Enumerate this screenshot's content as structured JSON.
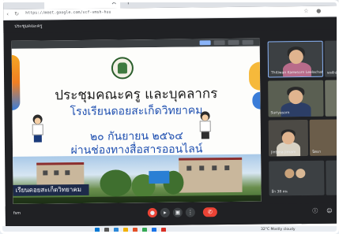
{
  "browser": {
    "url": "https://meet.google.com/xcf-vmsh-huu",
    "new_tab_symbol": "+",
    "close_symbol": "×"
  },
  "meet": {
    "header_title": "ประชุมคณะครู",
    "meeting_code": "fsm"
  },
  "slide": {
    "title": "ประชุมคณะครู และบุคลากร",
    "school": "โรงเรียนดอยสะเก็ดวิทยาคม",
    "date": "๒๐ กันยายน ๒๕๖๔",
    "online": "ผ่านช่องทางสื่อสารออนไลน์",
    "sign_text": "เรียนดอยสะเก็ดวิทยาคม"
  },
  "participants": [
    {
      "name": "Thitiwan Kaewsorn Leelachat"
    },
    {
      "name": "Suriyasorn"
    },
    {
      "name": "Jintana jirnam"
    },
    {
      "name": "อีก 38 คน"
    }
  ],
  "right_edge_labels": [
    "พรศักดิ์",
    "นิตยา"
  ],
  "controls": {
    "mic_icon": "mic-off-icon",
    "cam_icon": "camera-icon",
    "present_icon": "present-icon",
    "more_icon": "more-icon",
    "end_icon": "end-call-icon"
  },
  "taskbar": {
    "weather": "32°C  Mostly cloudy"
  },
  "colors": {
    "meet_bg": "#202124",
    "tile_bg": "#3c4043",
    "end_call": "#ea4335",
    "slide_blue": "#1e4fb0"
  }
}
